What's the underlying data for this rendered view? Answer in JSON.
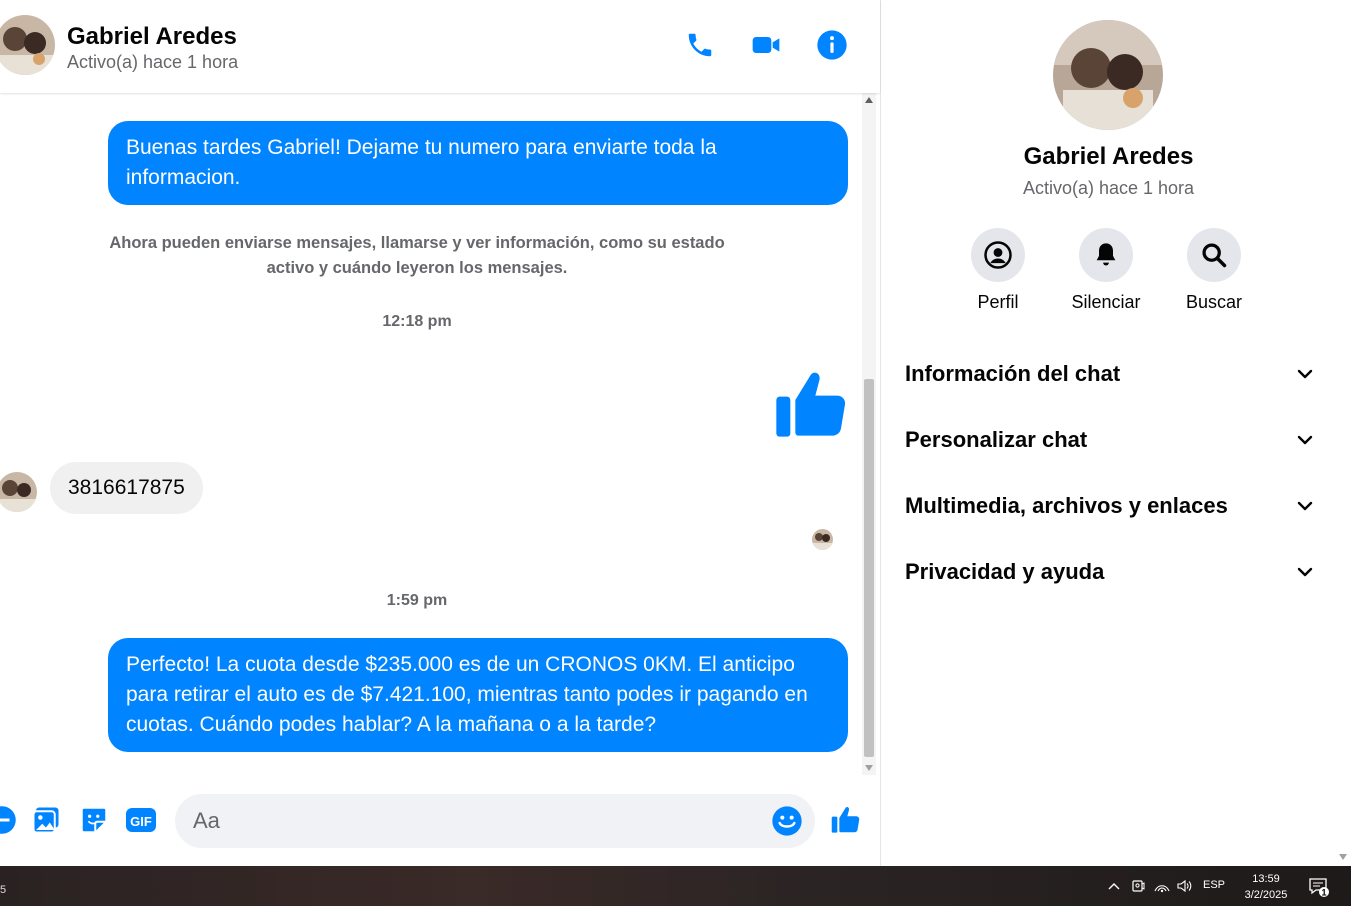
{
  "contact": {
    "name": "Gabriel Aredes",
    "status": "Activo(a) hace 1 hora"
  },
  "header": {
    "icons": [
      "phone-icon",
      "video-icon",
      "info-icon"
    ]
  },
  "messages": {
    "outgoing_1": "Buenas tardes Gabriel! Dejame tu numero para enviarte toda la informacion.",
    "system_note": "Ahora pueden enviarse mensajes, llamarse y ver información, como su estado activo y cuándo leyeron los mensajes.",
    "time_1": "12:18 pm",
    "incoming_1": "3816617875",
    "time_2": "1:59 pm",
    "outgoing_2": "Perfecto! La cuota desde $235.000 es de un CRONOS 0KM. El anticipo para retirar el auto es de $7.421.100, mientras tanto podes ir pagando en cuotas. Cuándo podes hablar? A la mañana o a la tarde?"
  },
  "composer": {
    "placeholder": "Aa",
    "icons": [
      "plus-icon",
      "image-icon",
      "sticker-icon",
      "gif-icon",
      "emoji-icon",
      "like-icon"
    ],
    "gif_label": "GIF"
  },
  "panel": {
    "actions": [
      {
        "label": "Perfil",
        "icon": "profile-icon"
      },
      {
        "label": "Silenciar",
        "icon": "bell-icon"
      },
      {
        "label": "Buscar",
        "icon": "search-icon"
      }
    ],
    "sections": [
      {
        "label": "Información del chat"
      },
      {
        "label": "Personalizar chat"
      },
      {
        "label": "Multimedia, archivos y enlaces"
      },
      {
        "label": "Privacidad y ayuda"
      }
    ]
  },
  "taskbar": {
    "left_badge": "5",
    "language": "ESP",
    "time": "13:59",
    "date": "3/2/2025",
    "notification_count": "1"
  },
  "colors": {
    "accent": "#0084ff",
    "incoming_bubble": "#f0f0f0",
    "muted_text": "#65676b"
  }
}
